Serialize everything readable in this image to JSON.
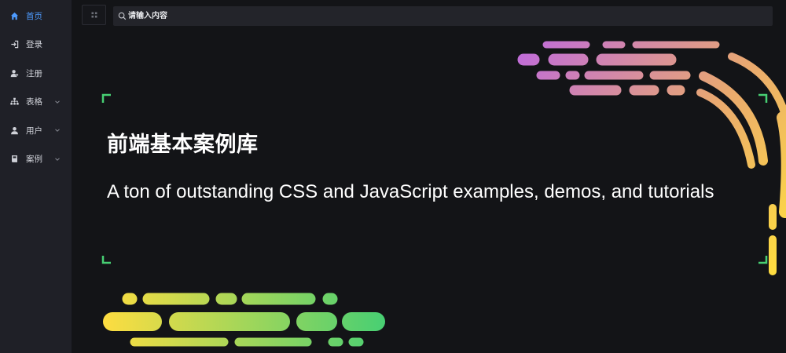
{
  "sidebar": {
    "items": [
      {
        "label": "首页",
        "icon": "home-icon",
        "active": true,
        "has_submenu": false
      },
      {
        "label": "登录",
        "icon": "login-icon",
        "active": false,
        "has_submenu": false
      },
      {
        "label": "注册",
        "icon": "user-add-icon",
        "active": false,
        "has_submenu": false
      },
      {
        "label": "表格",
        "icon": "sitemap-icon",
        "active": false,
        "has_submenu": true
      },
      {
        "label": "用户",
        "icon": "user-icon",
        "active": false,
        "has_submenu": true
      },
      {
        "label": "案例",
        "icon": "book-icon",
        "active": false,
        "has_submenu": true
      }
    ]
  },
  "topbar": {
    "menu_icon": "grid-icon",
    "search": {
      "placeholder": "请输入内容",
      "value": "",
      "icon": "search-icon"
    }
  },
  "hero": {
    "title": "前端基本案例库",
    "subtitle": "A ton of outstanding CSS and JavaScript examples, demos, and tutorials"
  },
  "colors": {
    "page_bg": "#131417",
    "sidebar_bg": "#1f2027",
    "accent": "#4d9bff",
    "corner_marks": "#47cf73",
    "stripes_top_start": "#bf6bdb",
    "stripes_top_end": "#ffdd40",
    "stripes_bottom_start": "#ffdd40",
    "stripes_bottom_end": "#47cf73"
  }
}
